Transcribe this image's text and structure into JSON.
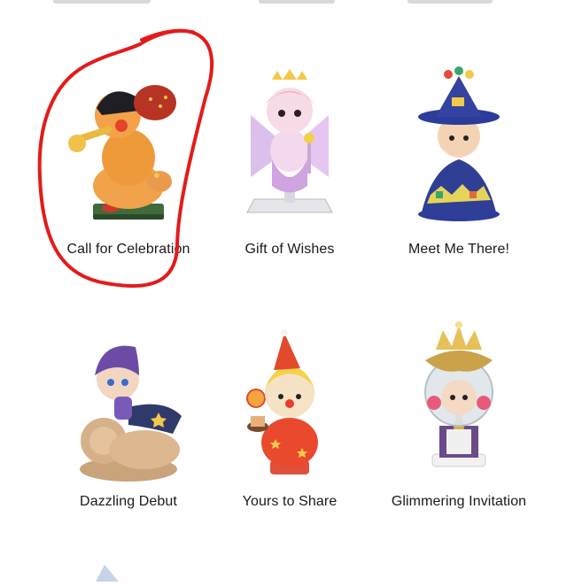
{
  "products": [
    {
      "name": "Call for Celebration",
      "icon": "trumpet-boy-figure-icon"
    },
    {
      "name": "Gift of Wishes",
      "icon": "fairy-girl-figure-icon"
    },
    {
      "name": "Meet Me There!",
      "icon": "wizard-figure-icon"
    },
    {
      "name": "Dazzling Debut",
      "icon": "lion-rider-figure-icon"
    },
    {
      "name": "Yours to Share",
      "icon": "party-clown-figure-icon"
    },
    {
      "name": "Glimmering Invitation",
      "icon": "crowned-globe-figure-icon"
    }
  ],
  "highlight": {
    "color": "#e31b1b",
    "target": "Call for Celebration"
  }
}
